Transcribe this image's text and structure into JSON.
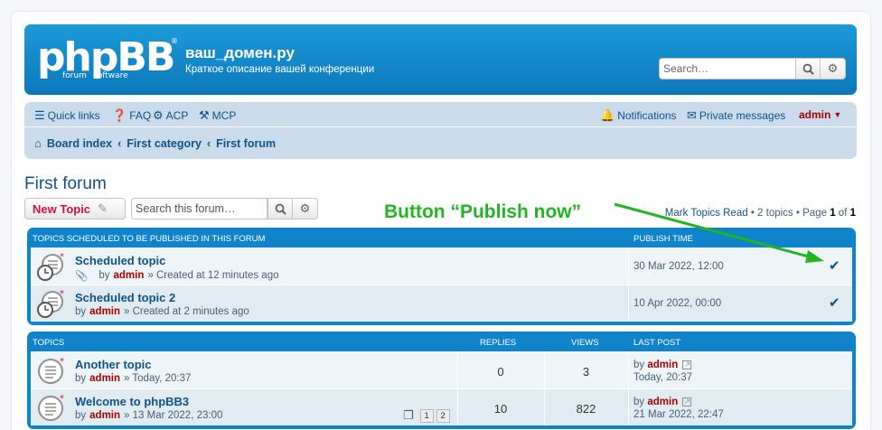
{
  "site": {
    "logo_text": "phpBB",
    "logo_sub_left": "forum",
    "logo_sub_right": "software",
    "title": "ваш_домен.ру",
    "description": "Краткое описание вашей конференции",
    "search_placeholder": "Search…"
  },
  "nav": {
    "quick_links": "Quick links",
    "faq": "FAQ",
    "acp": "ACP",
    "mcp": "MCP",
    "notifications": "Notifications",
    "private_messages": "Private messages",
    "user": "admin",
    "breadcrumbs": [
      "Board index",
      "First category",
      "First forum"
    ]
  },
  "forum": {
    "title": "First forum",
    "new_topic_label": "New Topic",
    "search_placeholder": "Search this forum…",
    "mark_read": "Mark Topics Read",
    "topics_count": "2 topics",
    "page_label": "Page",
    "page_current": "1",
    "page_of": "of",
    "page_total": "1"
  },
  "annotation": "Button “Publish now”",
  "scheduled": {
    "header": "Topics scheduled to be published in this forum",
    "publish_time_header": "Publish time",
    "rows": [
      {
        "title": "Scheduled topic",
        "by": "by",
        "author": "admin",
        "created": "» Created at 12 minutes ago",
        "publish_time": "30 Mar 2022, 12:00",
        "attachment": true
      },
      {
        "title": "Scheduled topic 2",
        "by": "by",
        "author": "admin",
        "created": "» Created at 2 minutes ago",
        "publish_time": "10 Apr 2022, 00:00",
        "attachment": false
      }
    ]
  },
  "topics": {
    "header": "Topics",
    "replies_header": "Replies",
    "views_header": "Views",
    "last_post_header": "Last post",
    "rows": [
      {
        "title": "Another topic",
        "by": "by",
        "author": "admin",
        "time": "» Today, 20:37",
        "replies": "0",
        "views": "3",
        "lp_by": "by",
        "lp_author": "admin",
        "lp_time": "Today, 20:37",
        "pages": []
      },
      {
        "title": "Welcome to phpBB3",
        "by": "by",
        "author": "admin",
        "time": "» 13 Mar 2022, 23:00",
        "replies": "10",
        "views": "822",
        "lp_by": "by",
        "lp_author": "admin",
        "lp_time": "21 Mar 2022, 22:47",
        "pages": [
          "1",
          "2"
        ]
      }
    ]
  },
  "colors": {
    "header_blue": "#0f84cb",
    "link": "#105289",
    "username": "#aa0000",
    "annotation": "#22b522"
  }
}
